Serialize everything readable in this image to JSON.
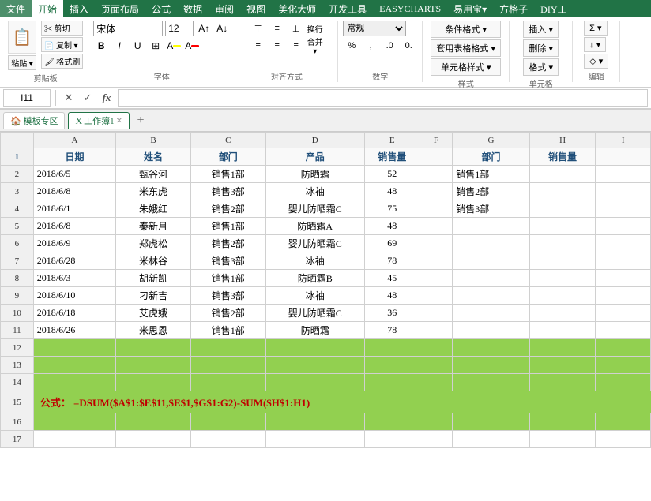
{
  "menus": [
    "文件",
    "开始",
    "插入",
    "页面布局",
    "公式",
    "数据",
    "审阅",
    "视图",
    "美化大师",
    "开发工具",
    "EASYCHARTS",
    "易用宝▾",
    "方格子",
    "DIY工"
  ],
  "activeMenu": "开始",
  "ribbon": {
    "groups": [
      {
        "label": "剪贴板"
      },
      {
        "label": "字体"
      },
      {
        "label": "对齐方式"
      },
      {
        "label": "数字"
      },
      {
        "label": "样式"
      },
      {
        "label": "单元格"
      },
      {
        "label": "编辑"
      }
    ],
    "fontName": "宋体",
    "fontSize": "12",
    "numberFormat": "常规"
  },
  "formulaBar": {
    "cellRef": "I11",
    "formula": ""
  },
  "tabs": [
    {
      "label": "模板专区",
      "type": "template"
    },
    {
      "label": "工作簿1",
      "type": "sheet",
      "active": true
    }
  ],
  "columns": [
    "",
    "A",
    "B",
    "C",
    "D",
    "E",
    "F",
    "G",
    "H",
    "I"
  ],
  "rows": [
    {
      "num": 1,
      "cells": [
        "日期",
        "姓名",
        "部门",
        "产品",
        "销售量",
        "",
        "部门",
        "销售量",
        ""
      ]
    },
    {
      "num": 2,
      "cells": [
        "2018/6/5",
        "甄谷河",
        "销售1部",
        "防晒霜",
        "52",
        "",
        "销售1部",
        "",
        ""
      ]
    },
    {
      "num": 3,
      "cells": [
        "2018/6/8",
        "米东虎",
        "销售3部",
        "冰袖",
        "48",
        "",
        "销售2部",
        "",
        ""
      ]
    },
    {
      "num": 4,
      "cells": [
        "2018/6/1",
        "朱娥红",
        "销售2部",
        "婴儿防晒霜C",
        "75",
        "",
        "销售3部",
        "",
        ""
      ]
    },
    {
      "num": 5,
      "cells": [
        "2018/6/8",
        "秦新月",
        "销售1部",
        "防晒霜A",
        "48",
        "",
        "",
        "",
        ""
      ]
    },
    {
      "num": 6,
      "cells": [
        "2018/6/9",
        "郑虎松",
        "销售2部",
        "婴儿防晒霜C",
        "69",
        "",
        "",
        "",
        ""
      ]
    },
    {
      "num": 7,
      "cells": [
        "2018/6/28",
        "米林谷",
        "销售3部",
        "冰袖",
        "78",
        "",
        "",
        "",
        ""
      ]
    },
    {
      "num": 8,
      "cells": [
        "2018/6/3",
        "胡新凯",
        "销售1部",
        "防晒霜B",
        "45",
        "",
        "",
        "",
        ""
      ]
    },
    {
      "num": 9,
      "cells": [
        "2018/6/10",
        "刁新吉",
        "销售3部",
        "冰袖",
        "48",
        "",
        "",
        "",
        ""
      ]
    },
    {
      "num": 10,
      "cells": [
        "2018/6/18",
        "艾虎娥",
        "销售2部",
        "婴儿防晒霜C",
        "36",
        "",
        "",
        "",
        ""
      ]
    },
    {
      "num": 11,
      "cells": [
        "2018/6/26",
        "米思恩",
        "销售1部",
        "防晒霜",
        "78",
        "",
        "",
        "",
        ""
      ]
    },
    {
      "num": 12,
      "cells": [
        "",
        "",
        "",
        "",
        "",
        "",
        "",
        "",
        ""
      ]
    },
    {
      "num": 13,
      "cells": [
        "",
        "",
        "",
        "",
        "",
        "",
        "",
        "",
        ""
      ]
    },
    {
      "num": 14,
      "cells": [
        "",
        "",
        "",
        "",
        "",
        "",
        "",
        "",
        ""
      ]
    },
    {
      "num": 15,
      "cells": [
        "",
        "",
        "",
        "",
        "",
        "",
        "",
        "",
        ""
      ],
      "formulaRow": true,
      "formulaText": "公式：  =DSUM($A$1:$E$11,$E$1,$G$1:G2)-SUM($H$1:H1)"
    },
    {
      "num": 16,
      "cells": [
        "",
        "",
        "",
        "",
        "",
        "",
        "",
        "",
        ""
      ]
    },
    {
      "num": 17,
      "cells": [
        "",
        "",
        "",
        "",
        "",
        "",
        "",
        "",
        ""
      ]
    }
  ],
  "formulaDisplay": "公式：  =DSUM($A$1:$E$11,$E$1,$G$1:G2)-SUM($H$1:H1)",
  "greenBgRows": [
    12,
    13,
    14,
    15,
    16
  ]
}
